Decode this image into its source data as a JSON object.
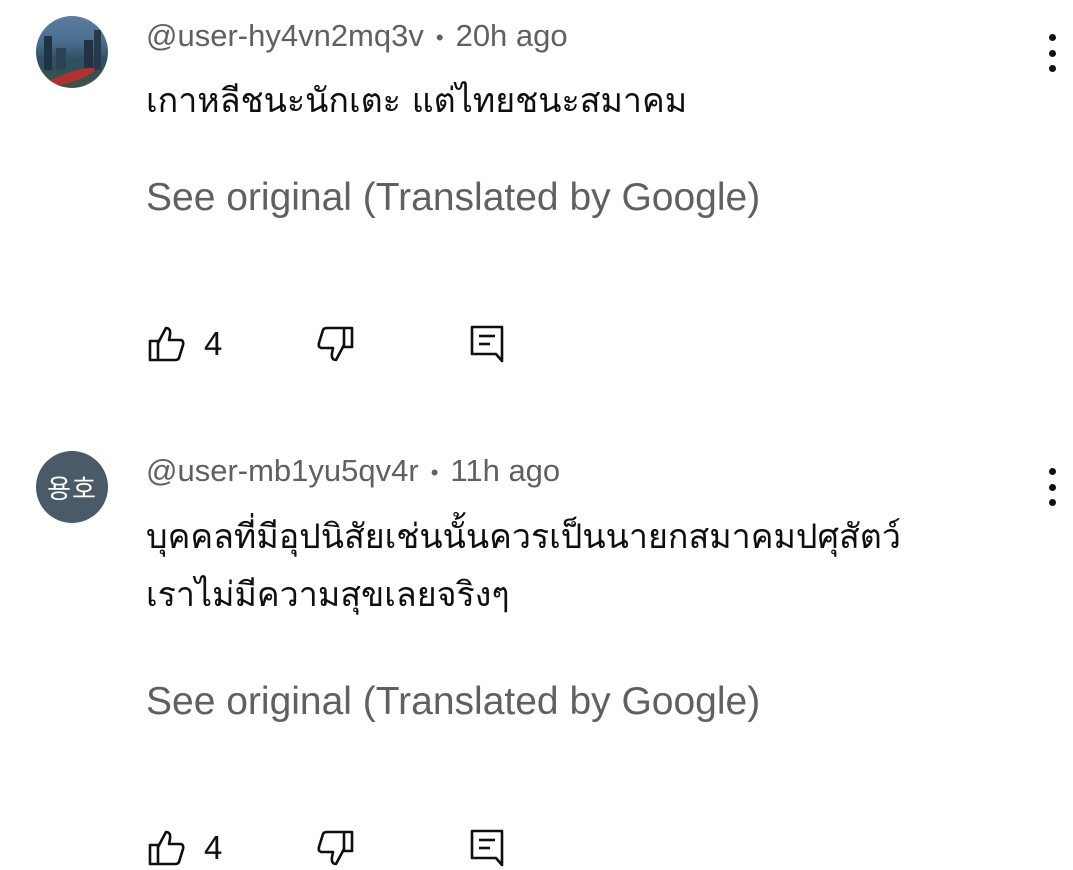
{
  "comments": [
    {
      "author": "@user-hy4vn2mq3v",
      "separator": "•",
      "time": "20h ago",
      "text_lines": [
        "เกาหลีชนะนักเตะ แต่ไทยชนะสมาคม"
      ],
      "see_original": "See original (Translated by Google)",
      "like_count": "4",
      "avatar": "city-photo"
    },
    {
      "author": "@user-mb1yu5qv4r",
      "separator": "•",
      "time": "11h ago",
      "avatar_initials": "용호",
      "text_lines": [
        "บุคคลที่มีอุปนิสัยเช่นนั้นควรเป็นนายกสมาคมปศุสัตว์",
        "เราไม่มีความสุขเลยจริงๆ"
      ],
      "see_original": "See original (Translated by Google)",
      "like_count": "4"
    }
  ],
  "icons": {
    "like": "thumb-up-icon",
    "dislike": "thumb-down-icon",
    "reply": "reply-comment-icon",
    "more": "more-vertical-icon"
  },
  "colors": {
    "text": "#0f0f0f",
    "secondary": "#606060",
    "avatar_bg": "#4a5a66"
  }
}
